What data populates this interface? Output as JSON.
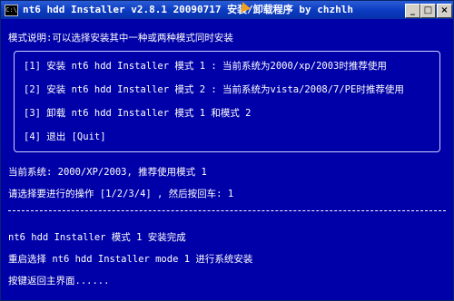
{
  "window": {
    "title": "nt6 hdd Installer v2.8.1 20090717 安装/卸载程序 by chzhlh",
    "icon_label": "C:\\",
    "buttons": {
      "minimize": "_",
      "maximize": "□",
      "close": "×"
    }
  },
  "console": {
    "mode_note": "模式说明:可以选择安装其中一种或两种模式同时安装",
    "menu": [
      "[1] 安装 nt6 hdd Installer 模式 1 : 当前系统为2000/xp/2003时推荐使用",
      "[2] 安装 nt6 hdd Installer 模式 2 : 当前系统为vista/2008/7/PE时推荐使用",
      "[3] 卸载 nt6 hdd Installer 模式 1 和模式 2",
      "[4] 退出 [Quit]"
    ],
    "current_system": "当前系统: 2000/XP/2003, 推荐使用模式 1",
    "prompt": "请选择要进行的操作 [1/2/3/4] , 然后按回车: 1",
    "status_done": "nt6 hdd Installer 模式 1 安装完成",
    "restart_note": "重启选择 nt6 hdd Installer mode 1 进行系统安装",
    "return_note": "按键返回主界面......"
  }
}
